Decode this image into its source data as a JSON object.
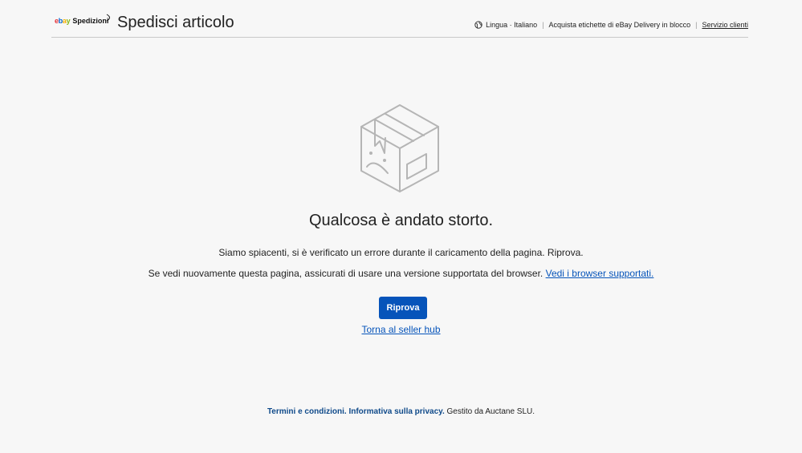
{
  "header": {
    "logo_brand": "ebay",
    "logo_text": "Spedizioni",
    "title": "Spedisci articolo",
    "language_label": "Lingua · Italiano",
    "bulk_labels": "Acquista etichette di eBay Delivery in blocco",
    "customer_service": "Servizio clienti"
  },
  "main": {
    "icon": "sad-box-icon",
    "heading": "Qualcosa è andato storto.",
    "message_1": "Siamo spiacenti, si è verificato un errore durante il caricamento della pagina. Riprova.",
    "message_2": "Se vedi nuovamente questa pagina, assicurati di usare una versione supportata del browser.",
    "browsers_link": "Vedi i browser supportati.",
    "retry_button": "Riprova",
    "back_link": "Torna al seller hub"
  },
  "footer": {
    "terms_link": "Termini e condizioni.",
    "privacy_link": "Informativa sulla privacy.",
    "managed_by": "Gestito da Auctane SLU."
  },
  "colors": {
    "primary_button": "#0654ba",
    "link": "#0654ba",
    "background": "#f7f7f7",
    "icon_stroke": "#b5b5b5"
  }
}
